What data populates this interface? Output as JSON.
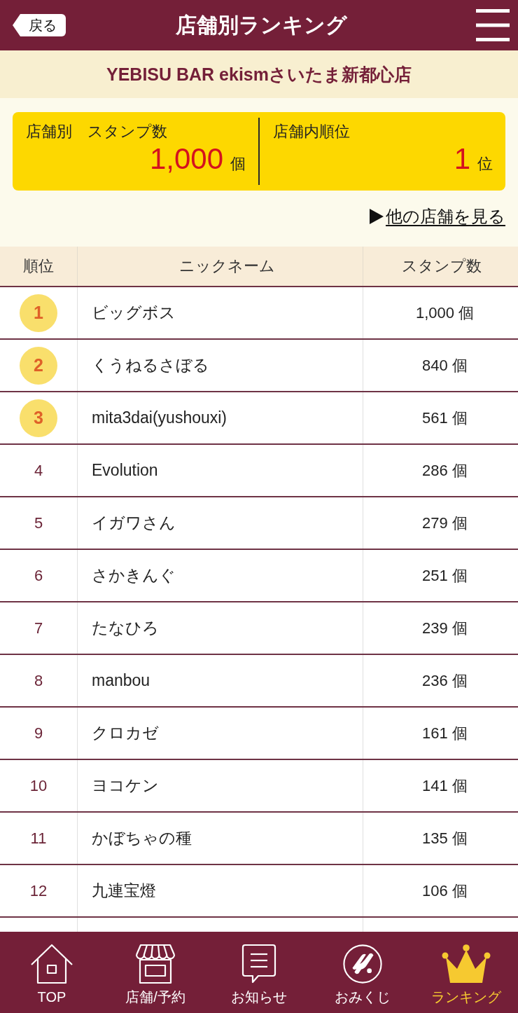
{
  "header": {
    "back_button": "戻る",
    "title": "店舗別ランキング"
  },
  "store_name": "YEBISU BAR ekismさいたま新都心店",
  "summary": [
    {
      "label": "店舗別　スタンプ数",
      "value": "1,000",
      "unit": "個"
    },
    {
      "label": "店舗内順位",
      "value": "1",
      "unit": "位"
    }
  ],
  "other_stores_link": "他の店舗を見る",
  "table": {
    "columns": [
      "順位",
      "ニックネーム",
      "スタンプ数"
    ],
    "rows": [
      {
        "rank": "1",
        "kind": "medal",
        "nickname": "ビッグボス",
        "stamps": "1,000 個"
      },
      {
        "rank": "2",
        "kind": "medal",
        "nickname": "くうねるさぼる",
        "stamps": "840 個"
      },
      {
        "rank": "3",
        "kind": "medal",
        "nickname": "mita3dai(yushouxi)",
        "stamps": "561 個"
      },
      {
        "rank": "4",
        "kind": "plain",
        "nickname": "Evolution",
        "stamps": "286 個"
      },
      {
        "rank": "5",
        "kind": "plain",
        "nickname": "イガワさん",
        "stamps": "279 個"
      },
      {
        "rank": "6",
        "kind": "plain",
        "nickname": "さかきんぐ",
        "stamps": "251 個"
      },
      {
        "rank": "7",
        "kind": "plain",
        "nickname": "たなひろ",
        "stamps": "239 個"
      },
      {
        "rank": "8",
        "kind": "plain",
        "nickname": "manbou",
        "stamps": "236 個"
      },
      {
        "rank": "9",
        "kind": "plain",
        "nickname": "クロカゼ",
        "stamps": "161 個"
      },
      {
        "rank": "10",
        "kind": "plain",
        "nickname": "ヨコケン",
        "stamps": "141 個"
      },
      {
        "rank": "11",
        "kind": "plain",
        "nickname": "かぼちゃの種",
        "stamps": "135 個"
      },
      {
        "rank": "12",
        "kind": "plain",
        "nickname": "九連宝燈",
        "stamps": "106 個"
      }
    ]
  },
  "tab_bar": [
    {
      "label": "TOP",
      "selected": false
    },
    {
      "label": "店舗/予約",
      "selected": false
    },
    {
      "label": "お知らせ",
      "selected": false
    },
    {
      "label": "おみくじ",
      "selected": false
    },
    {
      "label": "ランキング",
      "selected": true
    }
  ]
}
